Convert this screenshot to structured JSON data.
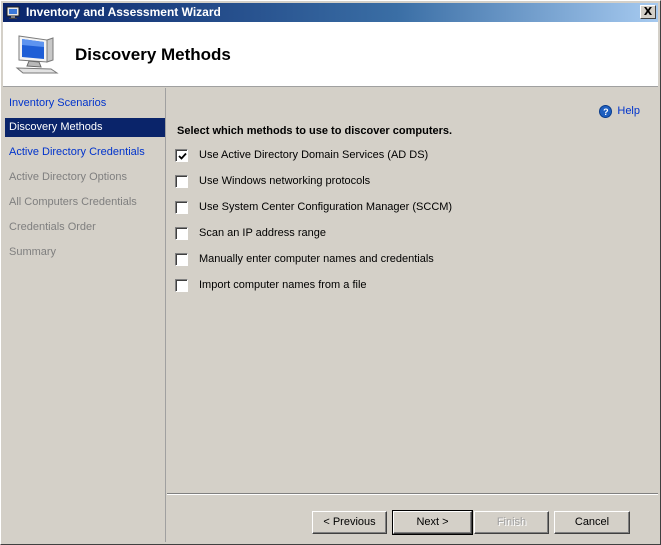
{
  "window": {
    "title": "Inventory and Assessment Wizard",
    "close_label": "X"
  },
  "header": {
    "title": "Discovery Methods",
    "icon": "computer-monitor-icon"
  },
  "nav": {
    "items": [
      {
        "label": "Inventory Scenarios",
        "state": "link"
      },
      {
        "label": "Discovery Methods",
        "state": "selected"
      },
      {
        "label": "Active Directory Credentials",
        "state": "link"
      },
      {
        "label": "Active Directory Options",
        "state": "disabled"
      },
      {
        "label": "All Computers Credentials",
        "state": "disabled"
      },
      {
        "label": "Credentials Order",
        "state": "disabled"
      },
      {
        "label": "Summary",
        "state": "disabled"
      }
    ]
  },
  "main": {
    "help_label": "Help",
    "instruction": "Select which methods to use to discover computers.",
    "options": [
      {
        "label": "Use Active Directory Domain Services (AD DS)",
        "checked": true
      },
      {
        "label": "Use Windows networking protocols",
        "checked": false
      },
      {
        "label": "Use System Center Configuration Manager (SCCM)",
        "checked": false
      },
      {
        "label": "Scan an IP address range",
        "checked": false
      },
      {
        "label": "Manually enter computer names and credentials",
        "checked": false
      },
      {
        "label": "Import computer names from a file",
        "checked": false
      }
    ]
  },
  "footer": {
    "previous_label": "< Previous",
    "next_label": "Next >",
    "finish_label": "Finish",
    "cancel_label": "Cancel"
  },
  "colors": {
    "selected_bg": "#0a246a",
    "link": "#0033cc",
    "disabled_text": "#7f7f7f"
  }
}
